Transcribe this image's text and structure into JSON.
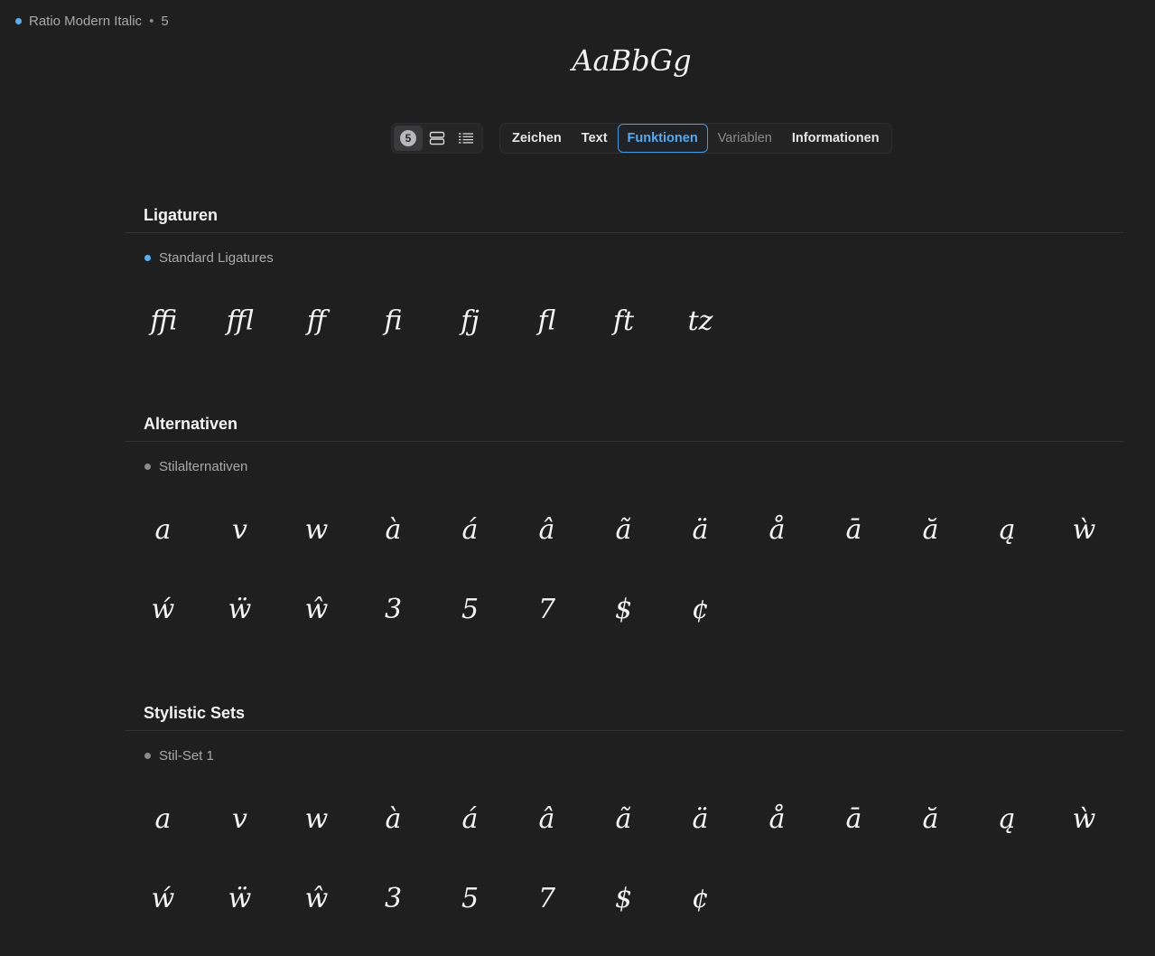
{
  "header": {
    "font_name": "Ratio Modern Italic",
    "separator": "•",
    "count": "5",
    "preview_text": "AaBbGg"
  },
  "view_modes": {
    "badge": "5",
    "icons": [
      "count-badge-icon",
      "rows-icon",
      "list-icon"
    ]
  },
  "tabs": [
    {
      "label": "Zeichen",
      "state": "normal"
    },
    {
      "label": "Text",
      "state": "normal"
    },
    {
      "label": "Funktionen",
      "state": "active"
    },
    {
      "label": "Variablen",
      "state": "disabled"
    },
    {
      "label": "Informationen",
      "state": "normal"
    }
  ],
  "sections": [
    {
      "title": "Ligaturen",
      "feature": "Standard Ligatures",
      "feature_active": true,
      "rows": [
        [
          "ﬃ",
          "ﬄ",
          "ﬀ",
          "ﬁ",
          "fj",
          "ﬂ",
          "ft",
          "tz"
        ]
      ]
    },
    {
      "title": "Alternativen",
      "feature": "Stilalternativen",
      "feature_active": false,
      "rows": [
        [
          "a",
          "v",
          "w",
          "à",
          "á",
          "â",
          "ã",
          "ä",
          "å",
          "ā",
          "ă",
          "ą",
          "ẁ"
        ],
        [
          "ẃ",
          "ẅ",
          "ŵ",
          "3",
          "5",
          "7",
          "$",
          "¢"
        ]
      ]
    },
    {
      "title": "Stylistic Sets",
      "feature": "Stil-Set 1",
      "feature_active": false,
      "rows": [
        [
          "a",
          "v",
          "w",
          "à",
          "á",
          "â",
          "ã",
          "ä",
          "å",
          "ā",
          "ă",
          "ą",
          "ẁ"
        ],
        [
          "ẃ",
          "ẅ",
          "ŵ",
          "3",
          "5",
          "7",
          "$",
          "¢"
        ]
      ]
    }
  ],
  "colors": {
    "background": "#1f1f20",
    "accent": "#5aaef0",
    "text": "#e8e8e8",
    "muted": "#a8a8aa"
  }
}
